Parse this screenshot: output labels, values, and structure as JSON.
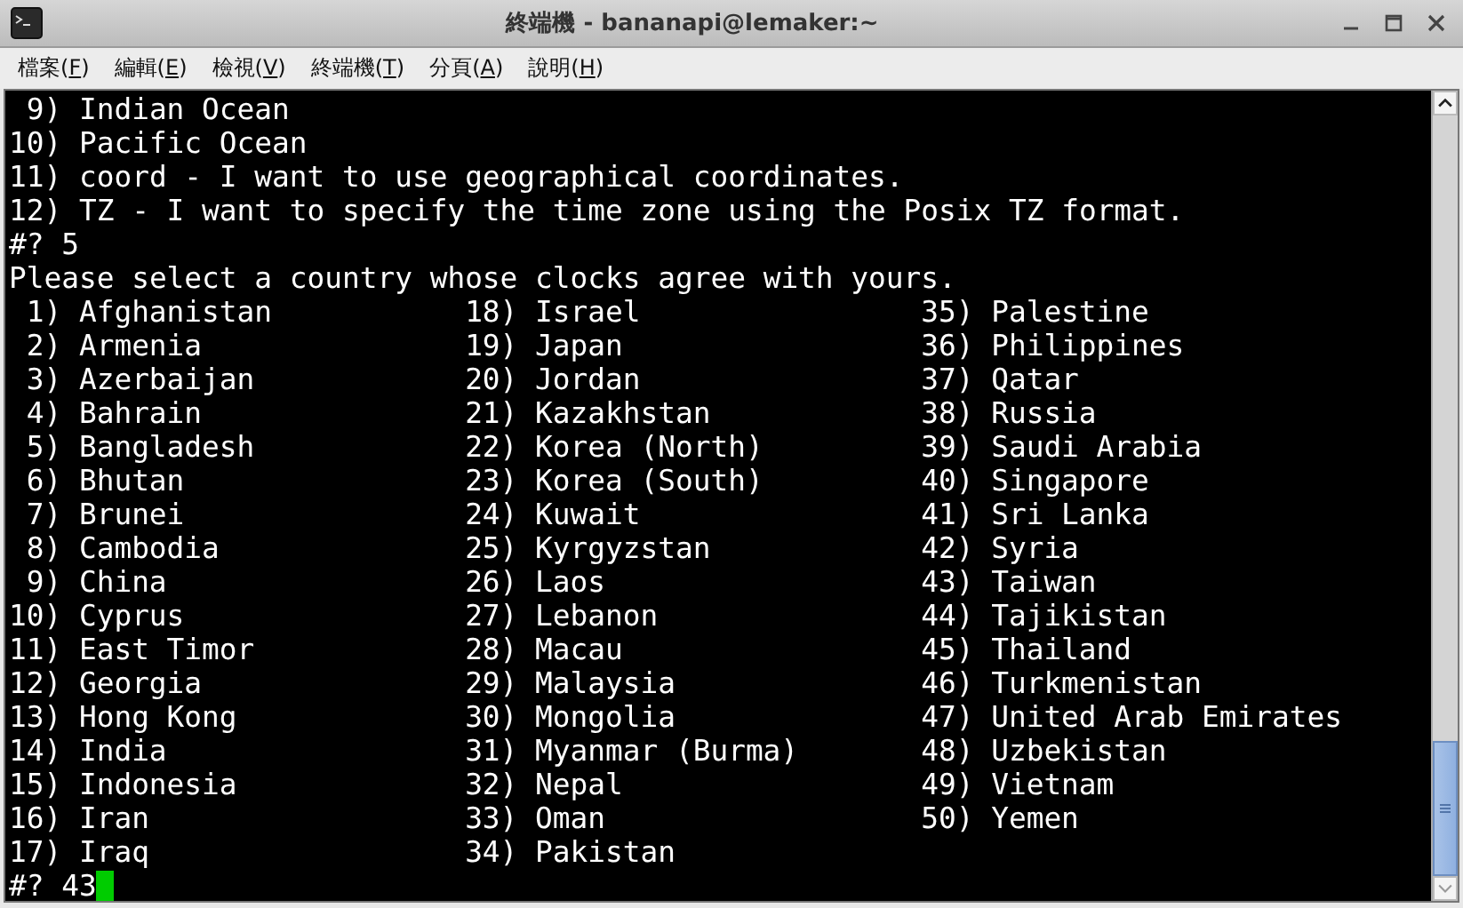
{
  "window": {
    "title": "終端機 - bananapi@lemaker:~"
  },
  "menu": [
    {
      "label": "檔案(F)"
    },
    {
      "label": "編輯(E)"
    },
    {
      "label": "檢視(V)"
    },
    {
      "label": "終端機(T)"
    },
    {
      "label": "分頁(A)"
    },
    {
      "label": "說明(H)"
    }
  ],
  "terminal": {
    "lines_before": [
      " 9) Indian Ocean",
      "10) Pacific Ocean",
      "11) coord - I want to use geographical coordinates.",
      "12) TZ - I want to specify the time zone using the Posix TZ format.",
      "#? 5",
      "Please select a country whose clocks agree with yours."
    ],
    "countries": [
      {
        "number": "1)",
        "name": "Afghanistan"
      },
      {
        "number": "2)",
        "name": "Armenia"
      },
      {
        "number": "3)",
        "name": "Azerbaijan"
      },
      {
        "number": "4)",
        "name": "Bahrain"
      },
      {
        "number": "5)",
        "name": "Bangladesh"
      },
      {
        "number": "6)",
        "name": "Bhutan"
      },
      {
        "number": "7)",
        "name": "Brunei"
      },
      {
        "number": "8)",
        "name": "Cambodia"
      },
      {
        "number": "9)",
        "name": "China"
      },
      {
        "number": "10)",
        "name": "Cyprus"
      },
      {
        "number": "11)",
        "name": "East Timor"
      },
      {
        "number": "12)",
        "name": "Georgia"
      },
      {
        "number": "13)",
        "name": "Hong Kong"
      },
      {
        "number": "14)",
        "name": "India"
      },
      {
        "number": "15)",
        "name": "Indonesia"
      },
      {
        "number": "16)",
        "name": "Iran"
      },
      {
        "number": "17)",
        "name": "Iraq"
      },
      {
        "number": "18)",
        "name": "Israel"
      },
      {
        "number": "19)",
        "name": "Japan"
      },
      {
        "number": "20)",
        "name": "Jordan"
      },
      {
        "number": "21)",
        "name": "Kazakhstan"
      },
      {
        "number": "22)",
        "name": "Korea (North)"
      },
      {
        "number": "23)",
        "name": "Korea (South)"
      },
      {
        "number": "24)",
        "name": "Kuwait"
      },
      {
        "number": "25)",
        "name": "Kyrgyzstan"
      },
      {
        "number": "26)",
        "name": "Laos"
      },
      {
        "number": "27)",
        "name": "Lebanon"
      },
      {
        "number": "28)",
        "name": "Macau"
      },
      {
        "number": "29)",
        "name": "Malaysia"
      },
      {
        "number": "30)",
        "name": "Mongolia"
      },
      {
        "number": "31)",
        "name": "Myanmar (Burma)"
      },
      {
        "number": "32)",
        "name": "Nepal"
      },
      {
        "number": "33)",
        "name": "Oman"
      },
      {
        "number": "34)",
        "name": "Pakistan"
      },
      {
        "number": "35)",
        "name": "Palestine"
      },
      {
        "number": "36)",
        "name": "Philippines"
      },
      {
        "number": "37)",
        "name": "Qatar"
      },
      {
        "number": "38)",
        "name": "Russia"
      },
      {
        "number": "39)",
        "name": "Saudi Arabia"
      },
      {
        "number": "40)",
        "name": "Singapore"
      },
      {
        "number": "41)",
        "name": "Sri Lanka"
      },
      {
        "number": "42)",
        "name": "Syria"
      },
      {
        "number": "43)",
        "name": "Taiwan"
      },
      {
        "number": "44)",
        "name": "Tajikistan"
      },
      {
        "number": "45)",
        "name": "Thailand"
      },
      {
        "number": "46)",
        "name": "Turkmenistan"
      },
      {
        "number": "47)",
        "name": "United Arab Emirates"
      },
      {
        "number": "48)",
        "name": "Uzbekistan"
      },
      {
        "number": "49)",
        "name": "Vietnam"
      },
      {
        "number": "50)",
        "name": "Yemen"
      }
    ],
    "prompt": "#? 43"
  }
}
